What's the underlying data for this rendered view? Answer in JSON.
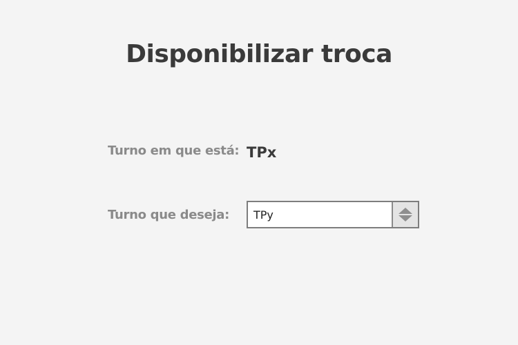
{
  "page": {
    "title": "Disponibilizar troca"
  },
  "form": {
    "current_shift_label": "Turno em que está:",
    "current_shift_value": "TPx",
    "desired_shift_label": "Turno que deseja:",
    "desired_shift_selected": "TPy"
  },
  "icons": {
    "spinner": "up-down-arrows-icon"
  }
}
